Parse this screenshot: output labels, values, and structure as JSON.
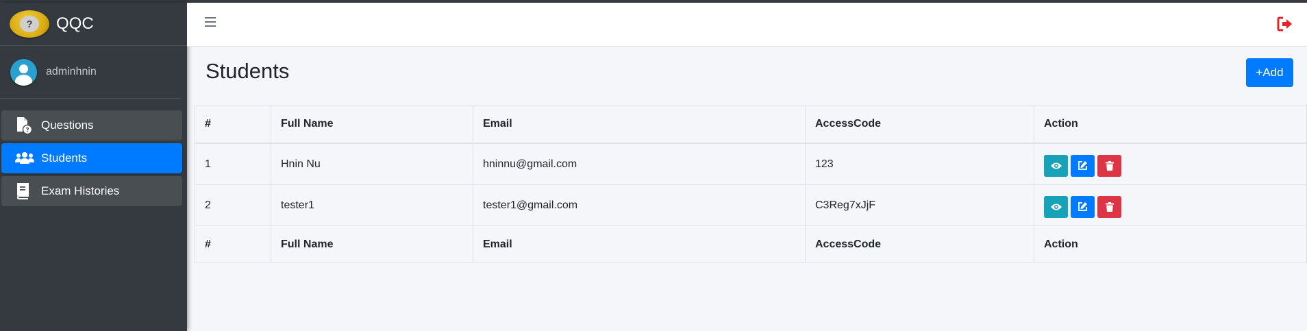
{
  "app": {
    "brand": "QQC",
    "user": "adminhnin"
  },
  "sidebar": {
    "items": [
      {
        "label": "Questions",
        "icon": "question-file-icon",
        "active": false
      },
      {
        "label": "Students",
        "icon": "users-icon",
        "active": true
      },
      {
        "label": "Exam Histories",
        "icon": "book-icon",
        "active": false
      }
    ]
  },
  "header": {
    "menu_icon": "hamburger-icon",
    "logout_icon": "sign-out-icon"
  },
  "main": {
    "title": "Students",
    "add_label": "+Add",
    "table": {
      "columns": [
        "#",
        "Full Name",
        "Email",
        "AccessCode",
        "Action"
      ],
      "rows": [
        {
          "num": "1",
          "name": "Hnin Nu",
          "email": "hninnu@gmail.com",
          "code": "123"
        },
        {
          "num": "2",
          "name": "tester1",
          "email": "tester1@gmail.com",
          "code": "C3Reg7xJjF"
        }
      ]
    }
  },
  "colors": {
    "sidebar": "#343a40",
    "primary": "#007bff",
    "info": "#17a2b8",
    "danger": "#dc3545",
    "logout": "#e3242b"
  }
}
